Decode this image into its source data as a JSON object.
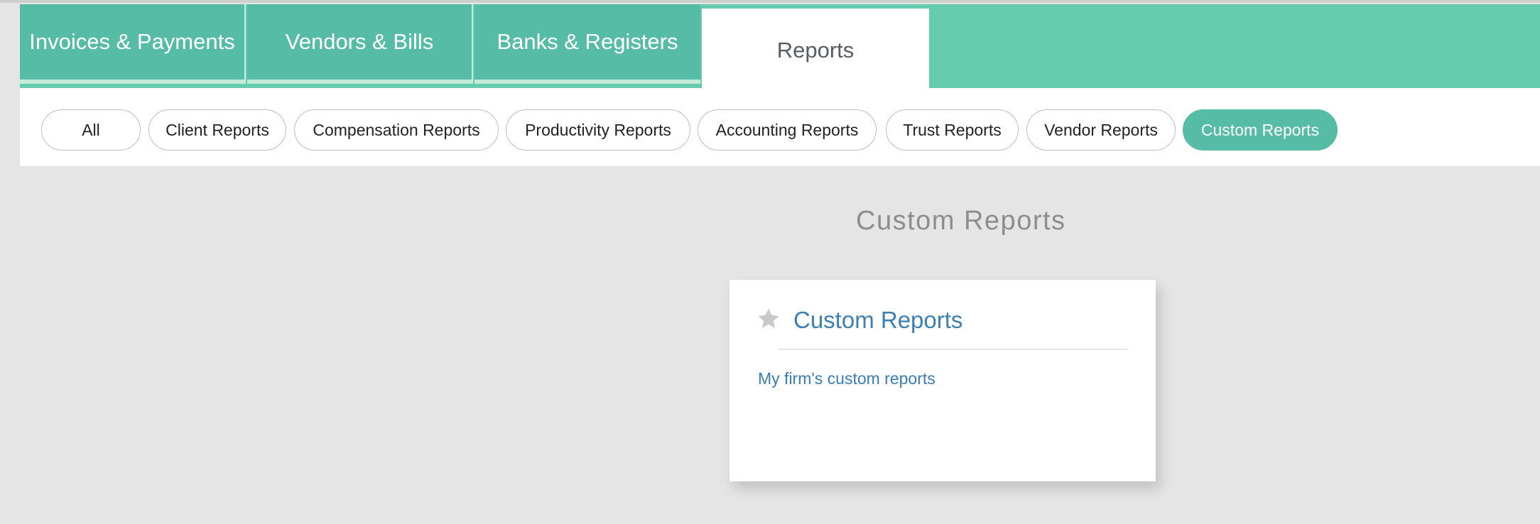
{
  "main_tabs": [
    {
      "label": "Invoices & Payments"
    },
    {
      "label": "Vendors & Bills"
    },
    {
      "label": "Banks & Registers"
    },
    {
      "label": "Reports",
      "active": true
    }
  ],
  "filters": [
    {
      "label": "All"
    },
    {
      "label": "Client Reports"
    },
    {
      "label": "Compensation Reports"
    },
    {
      "label": "Productivity Reports"
    },
    {
      "label": "Accounting Reports"
    },
    {
      "label": "Trust Reports"
    },
    {
      "label": "Vendor Reports"
    },
    {
      "label": "Custom Reports",
      "active": true
    }
  ],
  "section": {
    "title": "Custom Reports"
  },
  "card": {
    "title": "Custom Reports",
    "star_icon": "star-icon",
    "link": "My firm's custom reports"
  },
  "colors": {
    "accent": "#57bca6",
    "tabbar_bg": "#65cdab",
    "link": "#3b7fb4",
    "page_bg": "#e5e5e5"
  }
}
